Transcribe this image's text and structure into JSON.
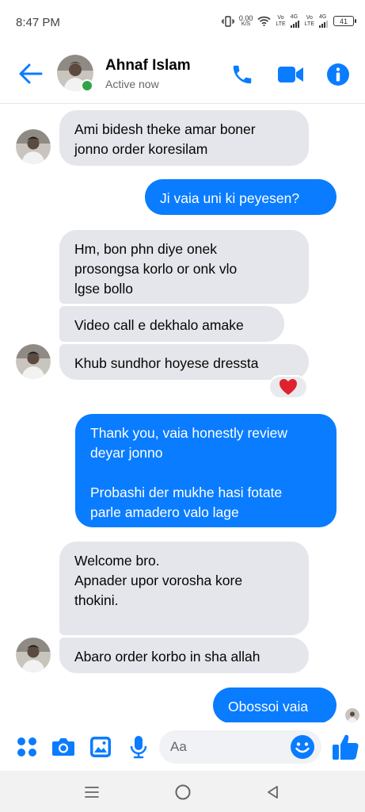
{
  "status_bar": {
    "time": "8:47 PM",
    "net_speed_value": "0.00",
    "net_speed_unit": "K/S",
    "sim1_label_top": "Vo",
    "sim1_label_bottom": "LTE",
    "sim1_network": "4G",
    "sim2_label_top": "Vo",
    "sim2_label_bottom": "LTE",
    "sim2_network": "4G",
    "battery": "41"
  },
  "header": {
    "contact_name": "Ahnaf Islam",
    "contact_status": "Active now",
    "back_icon": "back-arrow-icon",
    "call_icon": "phone-icon",
    "video_icon": "video-camera-icon",
    "info_icon": "info-icon"
  },
  "messages": [
    {
      "side": "incoming",
      "text": "Ami bidesh theke amar boner\njonno order koresilam"
    },
    {
      "side": "outgoing",
      "text": "Ji vaia uni ki peyesen?"
    },
    {
      "side": "incoming",
      "text": "Hm, bon phn diye onek\nprosongsa korlo or onk vlo\nlgse bollo"
    },
    {
      "side": "incoming",
      "text": "Video call e dekhalo amake"
    },
    {
      "side": "incoming",
      "text": "Khub sundhor hoyese dressta"
    },
    {
      "side": "outgoing",
      "text": "Thank you, vaia honestly review\ndeyar jonno\n\nProbashi der mukhe hasi fotate\nparle amadero valo lage"
    },
    {
      "side": "incoming",
      "text": "Welcome bro.\nApnader upor vorosha kore\nthokini."
    },
    {
      "side": "incoming",
      "text": "Abaro order korbo in sha allah"
    },
    {
      "side": "outgoing",
      "text": "Obossoi vaia"
    }
  ],
  "reaction": {
    "emoji": "heart-icon"
  },
  "composer": {
    "placeholder": "Aa",
    "icons": [
      "apps-grid-icon",
      "camera-icon",
      "gallery-icon",
      "microphone-icon",
      "emoji-icon",
      "thumbs-up-icon"
    ]
  },
  "nav_bar": {
    "icons": [
      "menu-icon",
      "home-icon",
      "back-icon"
    ]
  },
  "colors": {
    "accent": "#0a7cff",
    "incoming_bubble": "#e4e6eb",
    "active_dot": "#31a24c",
    "heart": "#e0222d"
  }
}
